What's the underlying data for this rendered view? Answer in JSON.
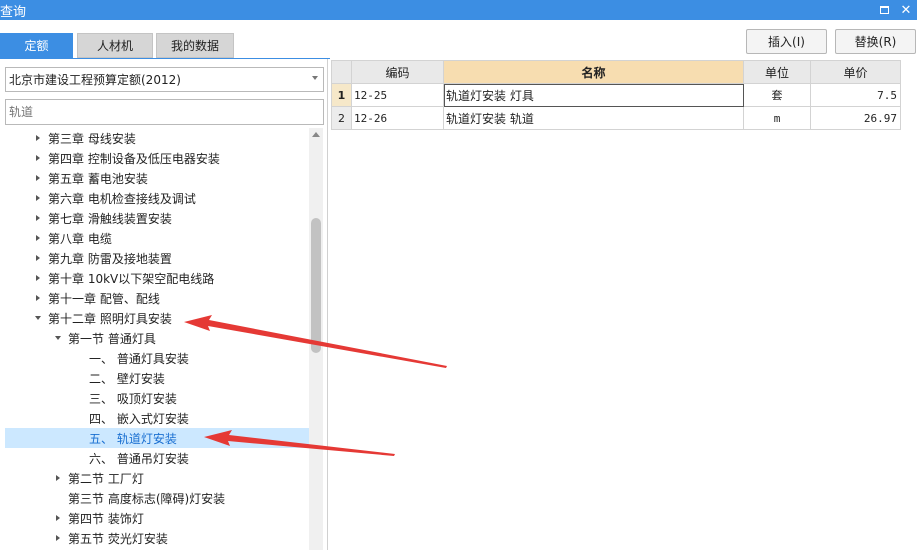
{
  "window": {
    "title": "查询"
  },
  "tabs": [
    {
      "label": "定额",
      "active": true
    },
    {
      "label": "人材机",
      "active": false
    },
    {
      "label": "我的数据",
      "active": false
    }
  ],
  "quota_library": {
    "selected": "北京市建设工程预算定额(2012)"
  },
  "search": {
    "value": "",
    "placeholder": "轨道"
  },
  "toolbar": {
    "insert_label": "插入(I)",
    "replace_label": "替换(R)"
  },
  "tree": [
    {
      "label": "第三章 母线安装",
      "level": 0,
      "expander": "collapsed"
    },
    {
      "label": "第四章 控制设备及低压电器安装",
      "level": 0,
      "expander": "collapsed"
    },
    {
      "label": "第五章 蓄电池安装",
      "level": 0,
      "expander": "collapsed"
    },
    {
      "label": "第六章 电机检查接线及调试",
      "level": 0,
      "expander": "collapsed"
    },
    {
      "label": "第七章 滑触线装置安装",
      "level": 0,
      "expander": "collapsed"
    },
    {
      "label": "第八章 电缆",
      "level": 0,
      "expander": "collapsed"
    },
    {
      "label": "第九章 防雷及接地装置",
      "level": 0,
      "expander": "collapsed"
    },
    {
      "label": "第十章 10kV以下架空配电线路",
      "level": 0,
      "expander": "collapsed"
    },
    {
      "label": "第十一章 配管、配线",
      "level": 0,
      "expander": "collapsed"
    },
    {
      "label": "第十二章 照明灯具安装",
      "level": 0,
      "expander": "expanded"
    },
    {
      "label": "第一节 普通灯具",
      "level": 1,
      "expander": "expanded"
    },
    {
      "label": "一、 普通灯具安装",
      "level": 2,
      "expander": "none"
    },
    {
      "label": "二、 壁灯安装",
      "level": 2,
      "expander": "none"
    },
    {
      "label": "三、 吸顶灯安装",
      "level": 2,
      "expander": "none"
    },
    {
      "label": "四、 嵌入式灯安装",
      "level": 2,
      "expander": "none"
    },
    {
      "label": "五、 轨道灯安装",
      "level": 2,
      "expander": "none",
      "selected": true
    },
    {
      "label": "六、 普通吊灯安装",
      "level": 2,
      "expander": "none"
    },
    {
      "label": "第二节 工厂灯",
      "level": 1,
      "expander": "collapsed"
    },
    {
      "label": "第三节 高度标志(障碍)灯安装",
      "level": 1,
      "expander": "none"
    },
    {
      "label": "第四节 装饰灯",
      "level": 1,
      "expander": "collapsed"
    },
    {
      "label": "第五节 荧光灯安装",
      "level": 1,
      "expander": "collapsed"
    }
  ],
  "grid": {
    "columns": [
      "编码",
      "名称",
      "单位",
      "单价"
    ],
    "rows": [
      {
        "no": "1",
        "code": "12-25",
        "name": "轨道灯安装 灯具",
        "unit": "套",
        "price": "7.5"
      },
      {
        "no": "2",
        "code": "12-26",
        "name": "轨道灯安装 轨道",
        "unit": "m",
        "price": "26.97"
      }
    ]
  },
  "colors": {
    "accent": "#3c8ee3",
    "selected_row": "#cce8ff",
    "name_header": "#f7ddb0",
    "arrow": "#e53935"
  }
}
